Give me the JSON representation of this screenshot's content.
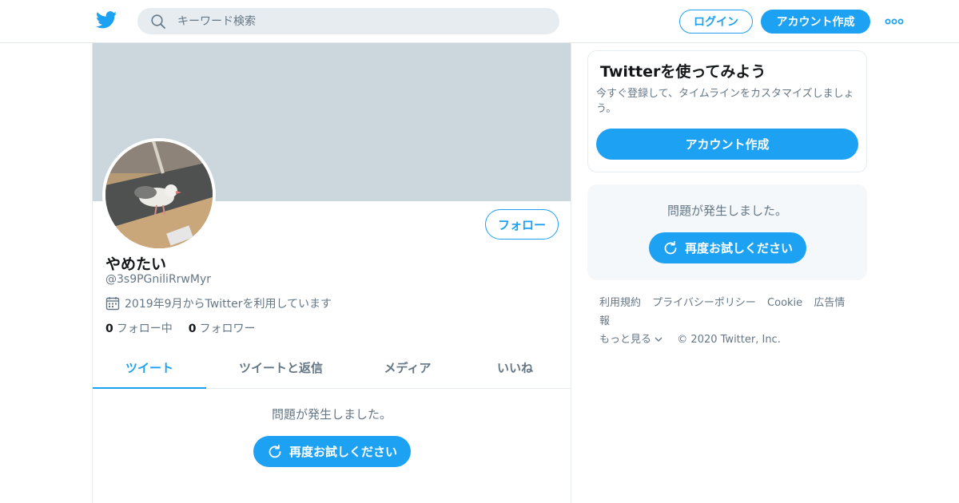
{
  "topbar": {
    "search_placeholder": "キーワード検索",
    "login_label": "ログイン",
    "signup_label": "アカウント作成"
  },
  "profile": {
    "follow_label": "フォロー",
    "display_name": "やめたい",
    "handle": "@3s9PGniliRrwMyr",
    "joined": "2019年9月からTwitterを利用しています",
    "following_count": "0",
    "following_label": "フォロー中",
    "followers_count": "0",
    "followers_label": "フォロワー"
  },
  "tabs": [
    {
      "label": "ツイート",
      "active": true
    },
    {
      "label": "ツイートと返信",
      "active": false
    },
    {
      "label": "メディア",
      "active": false
    },
    {
      "label": "いいね",
      "active": false
    }
  ],
  "main_error": {
    "message": "問題が発生しました。",
    "retry_label": "再度お試しください"
  },
  "signup_card": {
    "title": "Twitterを使ってみよう",
    "text": "今すぐ登録して、タイムラインをカスタマイズしましょう。",
    "button_label": "アカウント作成"
  },
  "side_error": {
    "message": "問題が発生しました。",
    "retry_label": "再度お試しください"
  },
  "footer": {
    "links": [
      "利用規約",
      "プライバシーポリシー",
      "Cookie",
      "広告情報"
    ],
    "more_label": "もっと見る",
    "copyright": "© 2020 Twitter, Inc."
  },
  "colors": {
    "accent": "#1da1f2",
    "banner": "#ccd6dd",
    "secondary_text": "#657786"
  },
  "icons": [
    "twitter-bird-icon",
    "search-icon",
    "more-dots-icon",
    "calendar-icon",
    "refresh-icon",
    "chevron-down-icon"
  ]
}
